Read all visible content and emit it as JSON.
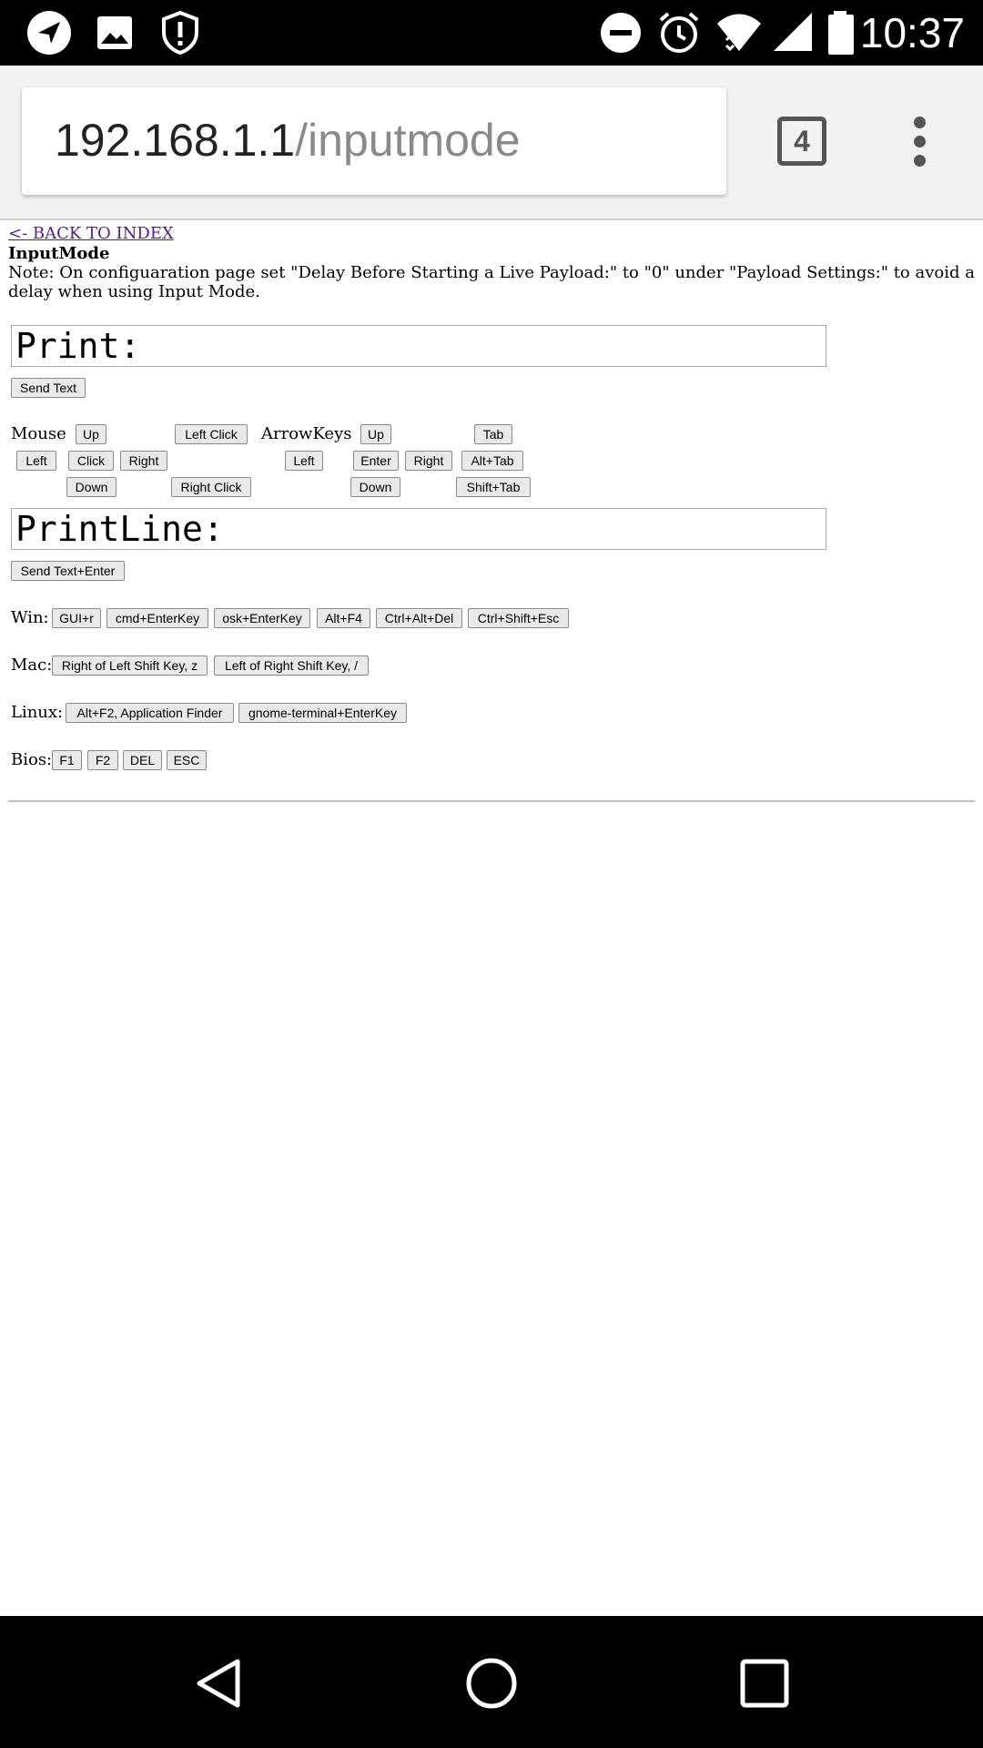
{
  "status_bar": {
    "time": "10:37",
    "icons": [
      "navigation-icon",
      "image-icon",
      "shield-alert-icon",
      "do-not-disturb-icon",
      "alarm-icon",
      "wifi-icon",
      "cell-signal-icon",
      "battery-icon"
    ]
  },
  "browser": {
    "url_host": "192.168.1.1",
    "url_path": "/inputmode",
    "tab_count": "4"
  },
  "page": {
    "back_link": "<- BACK TO INDEX",
    "title": "InputMode",
    "note": "Note: On configuaration page set \"Delay Before Starting a Live Payload:\" to \"0\" under \"Payload Settings:\" to avoid a delay when using Input Mode.",
    "print_field_value": "Print:",
    "send_text_button": "Send Text",
    "mouse": {
      "label": "Mouse",
      "up": "Up",
      "left": "Left",
      "click": "Click",
      "right": "Right",
      "down": "Down",
      "left_click": "Left Click",
      "right_click": "Right Click"
    },
    "arrowkeys": {
      "label": "ArrowKeys",
      "up": "Up",
      "left": "Left",
      "enter": "Enter",
      "right": "Right",
      "down": "Down",
      "tab": "Tab",
      "alt_tab": "Alt+Tab",
      "shift_tab": "Shift+Tab"
    },
    "printline_field_value": "PrintLine:",
    "send_text_enter_button": "Send Text+Enter",
    "win": {
      "label": "Win:",
      "buttons": [
        "GUI+r",
        "cmd+EnterKey",
        "osk+EnterKey",
        "Alt+F4",
        "Ctrl+Alt+Del",
        "Ctrl+Shift+Esc"
      ]
    },
    "mac": {
      "label": "Mac:",
      "buttons": [
        "Right of Left Shift Key, z",
        "Left of Right Shift Key, /"
      ]
    },
    "linux": {
      "label": "Linux:",
      "buttons": [
        "Alt+F2, Application Finder",
        "gnome-terminal+EnterKey"
      ]
    },
    "bios": {
      "label": "Bios:",
      "buttons": [
        "F1",
        "F2",
        "DEL",
        "ESC"
      ]
    }
  },
  "colors": {
    "status_bar_bg": "#000000",
    "toolbar_bg": "#f2f2f2",
    "link_visited": "#551a8b",
    "button_bg": "#e9e9e9"
  }
}
